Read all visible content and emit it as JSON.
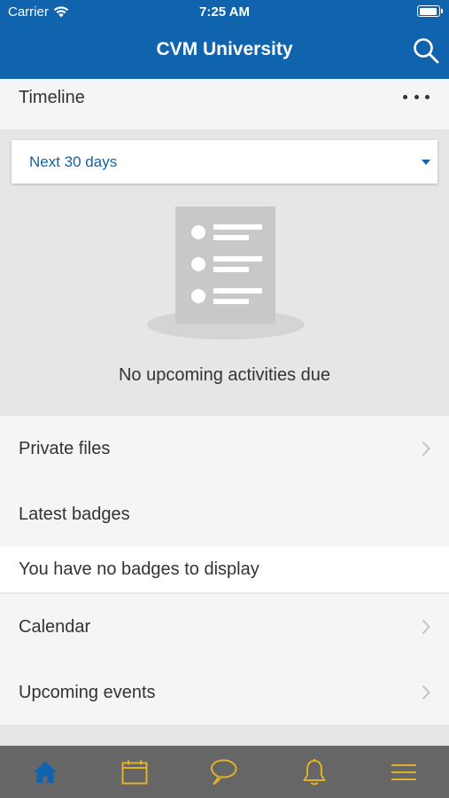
{
  "status_bar": {
    "carrier": "Carrier",
    "time": "7:25 AM"
  },
  "header": {
    "title": "CVM University"
  },
  "timeline": {
    "title": "Timeline",
    "filter_value": "Next 30 days",
    "empty_message": "No upcoming activities due"
  },
  "list": {
    "private_files": "Private files",
    "latest_badges": "Latest badges",
    "badges_empty": "You have no badges to display",
    "calendar": "Calendar",
    "upcoming_events": "Upcoming events"
  },
  "tab_bar": {
    "tabs": [
      {
        "icon": "home-icon",
        "active": true
      },
      {
        "icon": "calendar-icon",
        "active": false
      },
      {
        "icon": "messages-icon",
        "active": false
      },
      {
        "icon": "notifications-icon",
        "active": false
      },
      {
        "icon": "menu-icon",
        "active": false
      }
    ],
    "active_color": "#0f64ad",
    "inactive_color": "#e0b12a"
  },
  "colors": {
    "brand": "#0f64ad",
    "tab_bar_background": "#666666"
  }
}
